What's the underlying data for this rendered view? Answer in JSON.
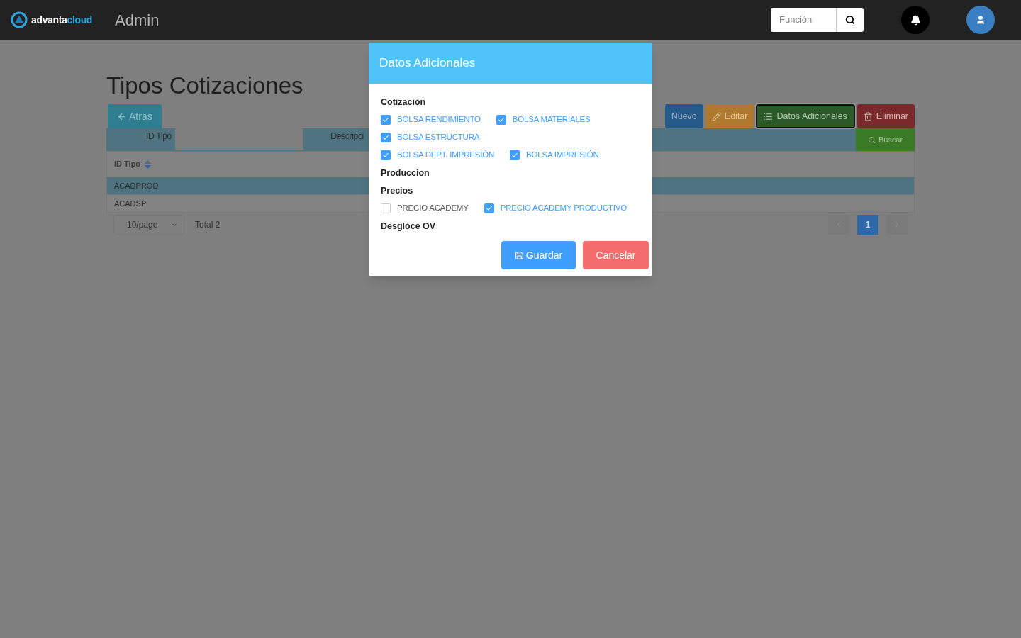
{
  "header": {
    "brand": {
      "part1": "advanta",
      "part2": "cloud"
    },
    "app_title": "Admin",
    "search": {
      "placeholder": "Función"
    }
  },
  "page": {
    "title": "Tipos Cotizaciones",
    "back_button": "Atras",
    "actions": [
      {
        "label": "Nuevo",
        "kind": "new"
      },
      {
        "label": "Editar",
        "kind": "edit"
      },
      {
        "label": "Datos Adicionales",
        "kind": "extra"
      },
      {
        "label": "Eliminar",
        "kind": "delete"
      }
    ],
    "filter": {
      "fields": [
        {
          "label": "ID Tipo"
        },
        {
          "label": "Descripci"
        }
      ],
      "search_button": "Buscar"
    },
    "table": {
      "columns": [
        {
          "label": "ID Tipo"
        }
      ],
      "rows": [
        {
          "cells": [
            "ACADPROD"
          ],
          "selected": true
        },
        {
          "cells": [
            "ACADSP"
          ],
          "selected": false
        }
      ]
    },
    "pagination": {
      "page_size": "10/page",
      "total": "Total 2",
      "pages": [
        {
          "label": "1",
          "selected": true
        }
      ]
    }
  },
  "modal": {
    "title": "Datos Adicionales",
    "sections": [
      {
        "title": "Cotización",
        "rows": [
          {
            "options": [
              {
                "label": "BOLSA RENDIMIENTO",
                "checked": true
              },
              {
                "label": "BOLSA MATERIALES",
                "checked": true
              }
            ]
          },
          {
            "options": [
              {
                "label": "BOLSA ESTRUCTURA",
                "checked": true
              }
            ]
          },
          {
            "options": [
              {
                "label": "BOLSA DEPT. IMPRESIÓN",
                "checked": true
              },
              {
                "label": "BOLSA IMPRESIÓN",
                "checked": true
              }
            ]
          }
        ]
      },
      {
        "title": "Produccion"
      },
      {
        "title": "Precios",
        "rows": [
          {
            "options": [
              {
                "label": "PRECIO ACADEMY",
                "checked": false
              },
              {
                "label": "PRECIO ACADEMY PRODUCTIVO",
                "checked": true
              }
            ]
          }
        ]
      },
      {
        "title": "Desgloce OV"
      }
    ],
    "save_button": "Guardar",
    "cancel_button": "Cancelar"
  }
}
